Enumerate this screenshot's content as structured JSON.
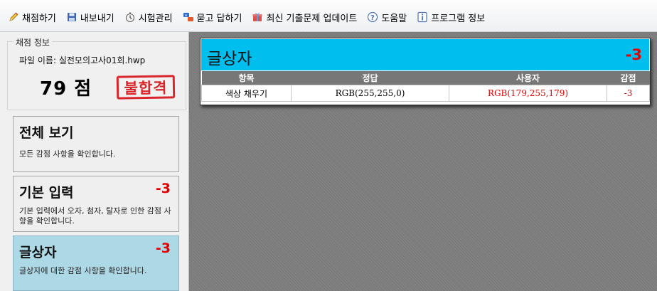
{
  "toolbar": {
    "items": [
      {
        "label": "채점하기",
        "icon": "pencil-icon"
      },
      {
        "label": "내보내기",
        "icon": "save-icon"
      },
      {
        "label": "시험관리",
        "icon": "stopwatch-icon"
      },
      {
        "label": "묻고 답하기",
        "icon": "qa-icon"
      },
      {
        "label": "최신 기출문제 업데이트",
        "icon": "gift-icon"
      },
      {
        "label": "도움말",
        "icon": "help-icon"
      },
      {
        "label": "프로그램 정보",
        "icon": "info-icon"
      }
    ]
  },
  "score_panel": {
    "legend": "채점 정보",
    "file_label": "파일 이름: 실전모의고사01회.hwp",
    "score": "79 점",
    "result_stamp": "불합격"
  },
  "categories": [
    {
      "title": "전체 보기",
      "penalty": "",
      "description": "모든 감점 사항을 확인합니다."
    },
    {
      "title": "기본 입력",
      "penalty": "-3",
      "description": "기본 입력에서 오자, 첨자, 탈자로 인한 감점 사항을 확인합니다."
    },
    {
      "title": "글상자",
      "penalty": "-3",
      "description": "글상자에 대한 감점 사항을 확인합니다."
    }
  ],
  "detail": {
    "title": "글상자",
    "penalty": "-3",
    "columns": [
      "항목",
      "정답",
      "사용자",
      "감점"
    ],
    "rows": [
      {
        "item": "색상 채우기",
        "answer": "RGB(255,255,0)",
        "user": "RGB(179,255,179)",
        "deduction": "-3"
      }
    ]
  },
  "colors": {
    "header_accent": "#00bfef",
    "active_card": "#add8e6",
    "penalty_red": "#e00000",
    "stamp_red": "#d9262a"
  }
}
